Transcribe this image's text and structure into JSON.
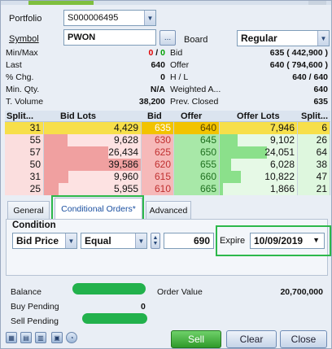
{
  "form": {
    "portfolio_label": "Portfolio",
    "portfolio_value": "S000006495",
    "symbol_label": "Symbol",
    "symbol_value": "PWON",
    "browse_label": "...",
    "board_label": "Board",
    "board_value": "Regular"
  },
  "info": {
    "left": [
      {
        "label": "Min/Max",
        "value_a": "0",
        "value_sep": " / ",
        "value_b": "0"
      },
      {
        "label": "Last",
        "value": "640"
      },
      {
        "label": "% Chg.",
        "value": "0"
      },
      {
        "label": "Min. Qty.",
        "value": "N/A"
      },
      {
        "label": "T. Volume",
        "value": "38,200"
      }
    ],
    "right": [
      {
        "label": "Bid",
        "value": "635 ( 442,900 )"
      },
      {
        "label": "Offer",
        "value": "640 ( 794,600 )"
      },
      {
        "label": "H / L",
        "value": "640 / 640"
      },
      {
        "label": "Weighted A...",
        "value": "640"
      },
      {
        "label": "Prev. Closed",
        "value": "635"
      }
    ]
  },
  "orderbook": {
    "headers": [
      "Split...",
      "Bid Lots",
      "Bid",
      "Offer",
      "Offer Lots",
      "Split..."
    ],
    "rows": [
      {
        "split_bid": "31",
        "bid_lots": "4,429",
        "bid": "635",
        "offer": "640",
        "offer_lots": "7,946",
        "split_offer": "6"
      },
      {
        "split_bid": "55",
        "bid_lots": "9,628",
        "bid": "630",
        "offer": "645",
        "offer_lots": "9,102",
        "split_offer": "26"
      },
      {
        "split_bid": "57",
        "bid_lots": "26,434",
        "bid": "625",
        "offer": "650",
        "offer_lots": "24,051",
        "split_offer": "64"
      },
      {
        "split_bid": "50",
        "bid_lots": "39,586",
        "bid": "620",
        "offer": "655",
        "offer_lots": "6,028",
        "split_offer": "38"
      },
      {
        "split_bid": "31",
        "bid_lots": "9,960",
        "bid": "615",
        "offer": "660",
        "offer_lots": "10,822",
        "split_offer": "47"
      },
      {
        "split_bid": "25",
        "bid_lots": "5,955",
        "bid": "610",
        "offer": "665",
        "offer_lots": "1,866",
        "split_offer": "21"
      }
    ]
  },
  "tabs": [
    {
      "label": "General"
    },
    {
      "label": "Conditional Orders*"
    },
    {
      "label": "Advanced"
    }
  ],
  "condition": {
    "title": "Condition",
    "field_value": "Bid Price",
    "operator_value": "Equal",
    "price_value": "690",
    "expire_label": "Expire",
    "expire_value": "10/09/2019"
  },
  "summary": {
    "balance_label": "Balance",
    "order_value_label": "Order Value",
    "order_value": "20,700,000",
    "buy_pending_label": "Buy Pending",
    "buy_pending_value": "0",
    "sell_pending_label": "Sell Pending"
  },
  "actions": {
    "sell": "Sell",
    "clear": "Clear",
    "close": "Close"
  },
  "colors": {
    "sell_green": "#2f9a2a",
    "highlight": "#2db84b",
    "bid_bar": "#f0a0a0",
    "offer_bar": "#8be08b"
  }
}
